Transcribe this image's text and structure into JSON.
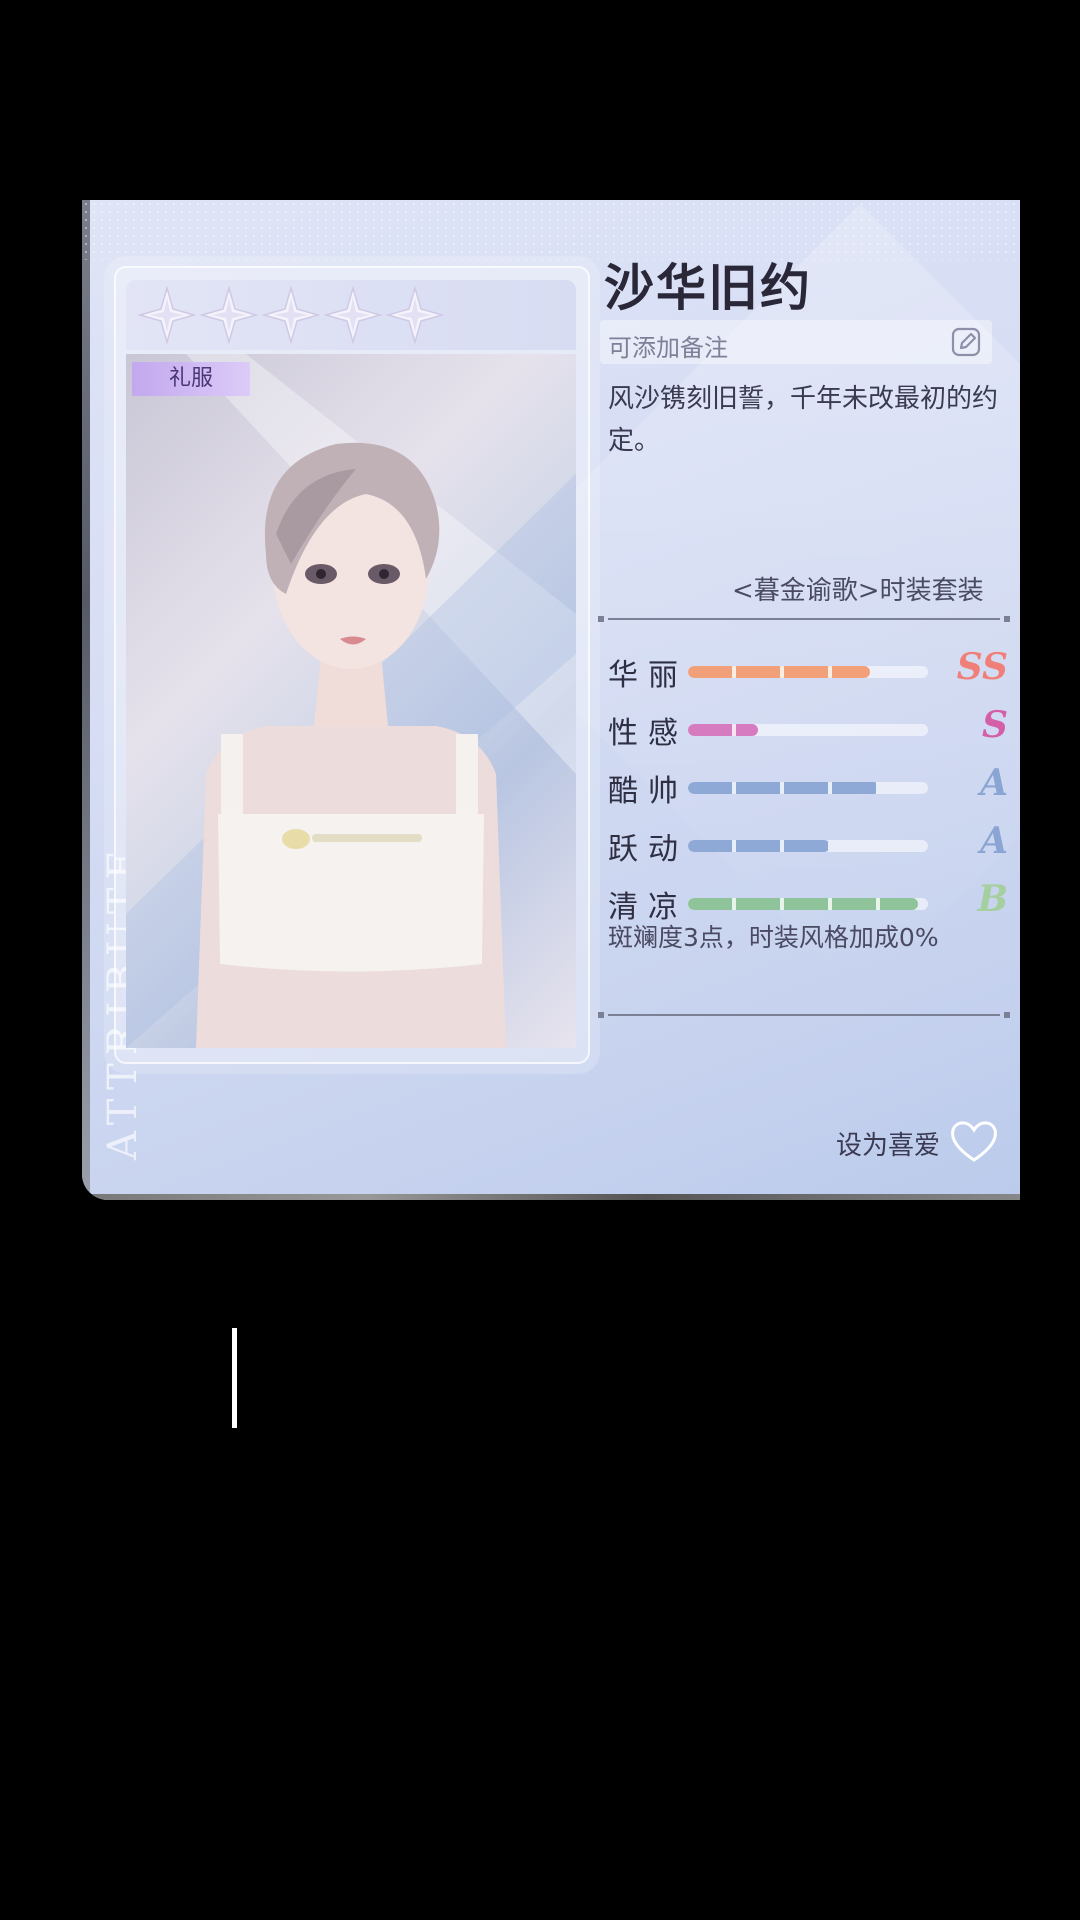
{
  "outfit": {
    "title": "沙华旧约",
    "note_placeholder": "可添加备注",
    "description": "风沙镌刻旧誓，千年未改最初的约定。",
    "set_name": "<暮金谕歌>时装套装",
    "tag": "礼服",
    "star_count": 5,
    "bonus_text": "斑斓度3点，时装风格加成0%",
    "favorite_label": "设为喜爱"
  },
  "stats": [
    {
      "label": "华丽",
      "level": 0.76,
      "grade": "SS",
      "color": "#f2a07a",
      "grade_color": "#ef7f78"
    },
    {
      "label": "性感",
      "level": 0.29,
      "grade": "S",
      "color": "#d77bc0",
      "grade_color": "#d45fa8"
    },
    {
      "label": "酷帅",
      "level": 0.8,
      "grade": "A",
      "color": "#8fa9d6",
      "grade_color": "#8aa5d4"
    },
    {
      "label": "跃动",
      "level": 0.59,
      "grade": "A",
      "color": "#8fa9d6",
      "grade_color": "#8aa5d4"
    },
    {
      "label": "清凉",
      "level": 0.96,
      "grade": "B",
      "color": "#8fc49a",
      "grade_color": "#a6cfa0"
    }
  ],
  "watermark": "ATTRIBUTE",
  "colors": {
    "card_bg": "#d6ddf4",
    "title": "#2a2838",
    "tag_bg": "#c3a8ee"
  }
}
